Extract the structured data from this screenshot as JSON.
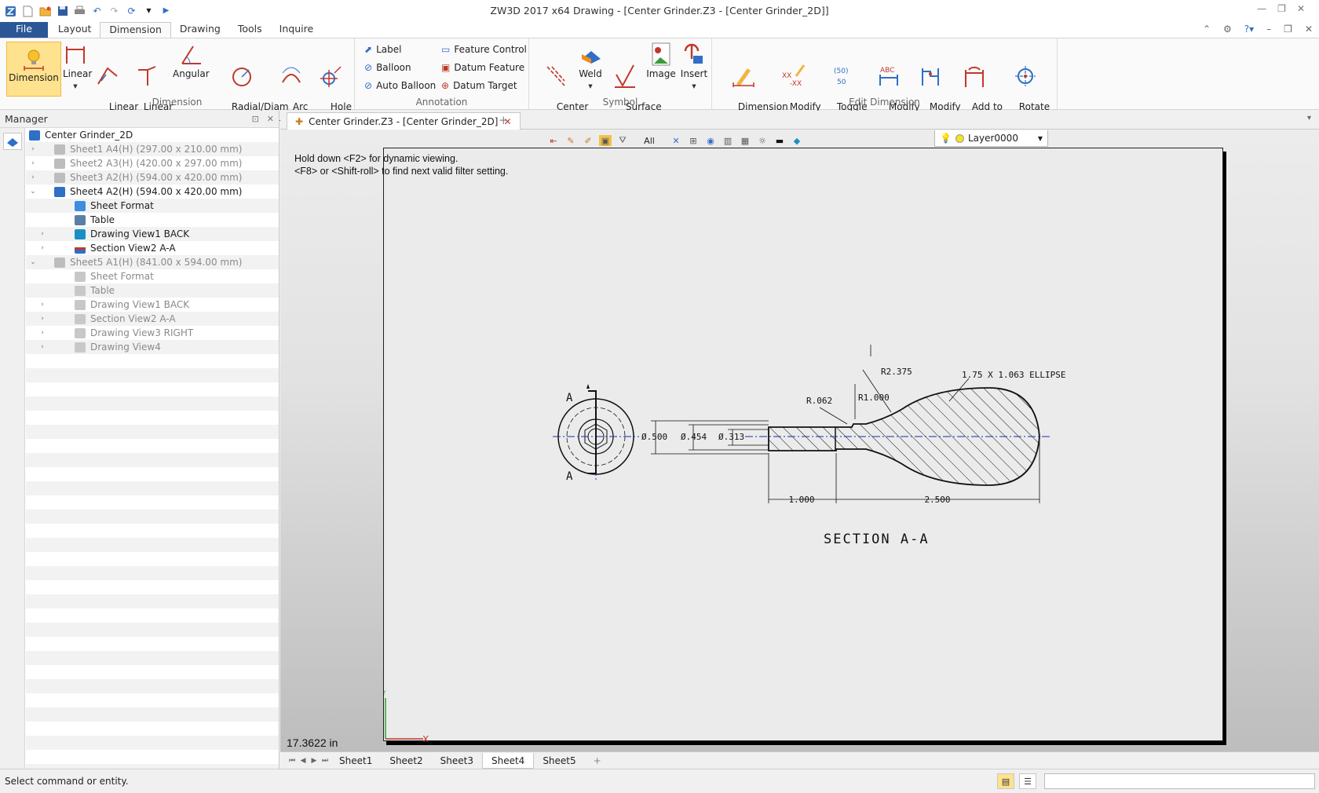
{
  "title": "ZW3D 2017  x64        Drawing - [Center Grinder.Z3 - [Center Grinder_2D]]",
  "menu": {
    "file": "File",
    "tabs": [
      "Layout",
      "Dimension",
      "Drawing",
      "Tools",
      "Inquire"
    ],
    "active": "Dimension"
  },
  "ribbon": {
    "dimension": {
      "label": "Dimension",
      "buttons": [
        "Dimension",
        "Linear",
        "Linear\nOffset",
        "Linear\nChamfer",
        "Angular",
        "Radial/Diam\netric",
        "Arc\nLength",
        "Hole\nCallout"
      ]
    },
    "annotation": {
      "label": "Annotation",
      "left": [
        "Label",
        "Balloon",
        "Auto Balloon"
      ],
      "right": [
        "Feature Control",
        "Datum Feature",
        "Datum Target"
      ]
    },
    "symbol": {
      "label": "Symbol",
      "buttons": [
        "Center\nLine",
        "Weld",
        "Surface\nFinish",
        "Image",
        "Insert"
      ]
    },
    "edit": {
      "label": "Edit Dimension",
      "buttons": [
        "Dimension\nQuick Edit",
        "Modify\nTolerance",
        "Toggle\nReference",
        "Modify\nText",
        "Modify\nDogleg",
        "Add to\nGroup",
        "Rotate\nCenter Mark"
      ]
    }
  },
  "manager": {
    "title": "Manager",
    "root": "Center Grinder_2D",
    "items": [
      {
        "label": "Sheet1 A4(H) (297.00 x 210.00 mm)"
      },
      {
        "label": "Sheet2 A3(H) (420.00 x 297.00 mm)"
      },
      {
        "label": "Sheet3 A2(H) (594.00 x 420.00 mm)"
      },
      {
        "label": "Sheet4 A2(H) (594.00 x 420.00 mm)"
      },
      {
        "label": "Sheet Format"
      },
      {
        "label": "Table"
      },
      {
        "label": "Drawing View1 BACK"
      },
      {
        "label": "Section View2 A-A"
      },
      {
        "label": "Sheet5 A1(H) (841.00 x 594.00 mm)"
      },
      {
        "label": "Sheet Format"
      },
      {
        "label": "Table"
      },
      {
        "label": "Drawing View1 BACK"
      },
      {
        "label": "Section View2 A-A"
      },
      {
        "label": "Drawing View3 RIGHT"
      },
      {
        "label": "Drawing View4"
      }
    ]
  },
  "doc_tab": "Center Grinder.Z3 - [Center Grinder_2D]",
  "viewport": {
    "filter": "All",
    "layer": "Layer0000",
    "hint_line1": "Hold down <F2> for dynamic viewing.",
    "hint_line2": "<F8> or <Shift-roll> to find next valid filter setting.",
    "scale_readout": "17.3622 in"
  },
  "drawing": {
    "section_label": "A",
    "dims": {
      "d1": "Ø.500",
      "d2": "Ø.454",
      "d3": "Ø.313",
      "r1": "R.062",
      "r2": "R1.000",
      "r3": "R2.375",
      "ellipse": "1.75 X 1.063 ELLIPSE",
      "len1": "1.000",
      "len2": "2.500"
    },
    "title": "SECTION A-A",
    "axis_x": "X",
    "axis_y": "Y"
  },
  "sheet_tabs": [
    "Sheet1",
    "Sheet2",
    "Sheet3",
    "Sheet4",
    "Sheet5"
  ],
  "active_sheet": "Sheet4",
  "status": "Select command or entity."
}
